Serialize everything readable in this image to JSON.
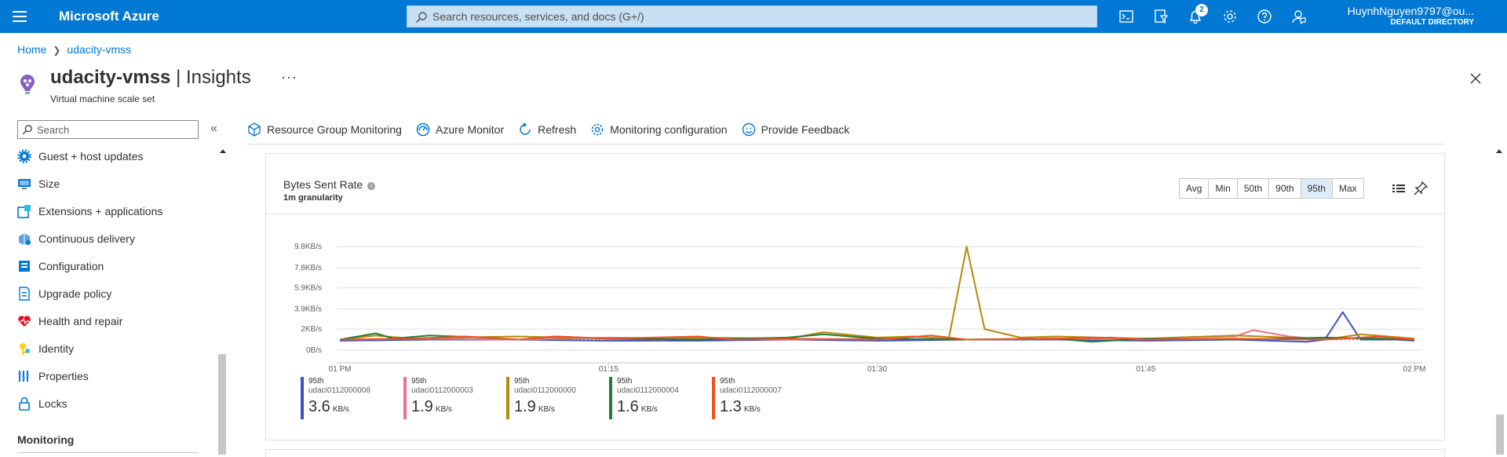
{
  "topbar": {
    "brand": "Microsoft Azure",
    "search_placeholder": "Search resources, services, and docs (G+/)",
    "notification_count": "2",
    "user_name": "HuynhNguyen9797@ou...",
    "user_directory": "DEFAULT DIRECTORY",
    "color": "#0078d4"
  },
  "breadcrumb": {
    "home": "Home",
    "current": "udacity-vmss"
  },
  "header": {
    "resource_name": "udacity-vmss",
    "separator": " | ",
    "blade_name": "Insights",
    "subtitle": "Virtual machine scale set",
    "more": "···"
  },
  "nav": {
    "search_placeholder": "Search",
    "collapse": "«",
    "items": [
      {
        "label": "Guest + host updates",
        "icon": "gear-icon"
      },
      {
        "label": "Size",
        "icon": "monitor-icon"
      },
      {
        "label": "Extensions + applications",
        "icon": "extensions-icon"
      },
      {
        "label": "Continuous delivery",
        "icon": "delivery-icon"
      },
      {
        "label": "Configuration",
        "icon": "configuration-icon"
      },
      {
        "label": "Upgrade policy",
        "icon": "policy-icon"
      },
      {
        "label": "Health and repair",
        "icon": "heart-icon"
      },
      {
        "label": "Identity",
        "icon": "identity-icon"
      },
      {
        "label": "Properties",
        "icon": "properties-icon"
      },
      {
        "label": "Locks",
        "icon": "lock-icon"
      }
    ],
    "group_label": "Monitoring"
  },
  "commands": [
    {
      "label": "Resource Group Monitoring",
      "icon": "cube-icon"
    },
    {
      "label": "Azure Monitor",
      "icon": "gauge-icon"
    },
    {
      "label": "Refresh",
      "icon": "refresh-icon"
    },
    {
      "label": "Monitoring configuration",
      "icon": "gear-icon"
    },
    {
      "label": "Provide Feedback",
      "icon": "smiley-icon"
    }
  ],
  "card": {
    "title": "Bytes Sent Rate",
    "granularity": "1m granularity",
    "aggregations": [
      "Avg",
      "Min",
      "50th",
      "90th",
      "95th",
      "Max"
    ],
    "selected_aggregation": "95th"
  },
  "chart_data": {
    "type": "line",
    "title": "Bytes Sent Rate",
    "yunit": "KB/s",
    "ylim": [
      0,
      11
    ],
    "y_ticks": [
      0,
      2,
      3.9,
      5.9,
      7.8,
      9.8
    ],
    "y_tick_labels": [
      "0B/s",
      "2KB/s",
      "3.9KB/s",
      "5.9KB/s",
      "7.8KB/s",
      "9.8KB/s"
    ],
    "x_tick_labels": [
      "01 PM",
      "01:15",
      "01:30",
      "01:45",
      "02 PM"
    ],
    "x_minutes": [
      0,
      15,
      30,
      45,
      60
    ],
    "grid": true,
    "series": [
      {
        "name": "udaci0112000008",
        "aggregation": "95th",
        "value_label": "3.6",
        "unit": "KB/s",
        "color": "#3c50c8",
        "x": [
          0,
          5,
          10,
          15,
          20,
          25,
          30,
          35,
          40,
          45,
          50,
          52,
          54,
          55,
          56,
          57,
          58,
          59,
          60
        ],
        "y": [
          0.9,
          1.0,
          1.0,
          0.9,
          0.9,
          1.0,
          0.9,
          1.0,
          1.0,
          0.9,
          1.0,
          0.9,
          0.8,
          1.0,
          3.6,
          1.0,
          1.0,
          1.0,
          0.9
        ]
      },
      {
        "name": "udaci0112000003",
        "aggregation": "95th",
        "value_label": "1.9",
        "unit": "KB/s",
        "color": "#e8748c",
        "x": [
          0,
          5,
          10,
          15,
          20,
          25,
          30,
          35,
          40,
          45,
          47,
          50,
          51,
          53,
          55,
          57,
          60
        ],
        "y": [
          1.0,
          1.1,
          1.0,
          1.2,
          1.1,
          1.0,
          1.1,
          1.0,
          1.1,
          1.0,
          1.2,
          1.3,
          1.9,
          1.3,
          1.0,
          1.2,
          1.0
        ]
      },
      {
        "name": "udaci0112000000",
        "aggregation": "95th",
        "value_label": "1.9",
        "unit": "KB/s",
        "color": "#b8860b",
        "x": [
          0,
          2,
          4,
          6,
          10,
          15,
          18,
          20,
          25,
          27,
          30,
          32,
          34,
          35,
          36,
          37,
          38,
          40,
          45,
          50,
          53,
          55,
          57,
          60
        ],
        "y": [
          1.0,
          1.4,
          1.1,
          1.2,
          1.3,
          1.1,
          1.0,
          1.2,
          1.1,
          1.7,
          1.2,
          1.3,
          1.1,
          9.8,
          2.0,
          1.6,
          1.2,
          1.3,
          1.1,
          1.4,
          1.2,
          1.0,
          1.5,
          1.1
        ]
      },
      {
        "name": "udaci0112000004",
        "aggregation": "95th",
        "value_label": "1.6",
        "unit": "KB/s",
        "color": "#1e7d3c",
        "x": [
          0,
          2,
          3,
          5,
          8,
          10,
          12,
          15,
          20,
          25,
          27,
          30,
          35,
          40,
          42,
          45,
          50,
          55,
          60
        ],
        "y": [
          1.0,
          1.6,
          1.1,
          1.4,
          1.2,
          1.0,
          1.3,
          1.1,
          1.0,
          1.2,
          1.5,
          1.1,
          1.0,
          1.1,
          0.8,
          1.1,
          1.0,
          1.2,
          1.0
        ]
      },
      {
        "name": "udaci0112000007",
        "aggregation": "95th",
        "value_label": "1.3",
        "unit": "KB/s",
        "color": "#f0501e",
        "x": [
          0,
          4,
          7,
          10,
          12,
          15,
          20,
          22,
          25,
          30,
          33,
          35,
          40,
          43,
          45,
          50,
          55,
          58,
          60
        ],
        "y": [
          1.0,
          1.1,
          1.3,
          1.0,
          1.3,
          1.1,
          1.3,
          1.0,
          1.1,
          1.0,
          1.4,
          1.0,
          1.1,
          1.2,
          1.0,
          1.1,
          1.0,
          1.3,
          1.0
        ]
      }
    ]
  }
}
